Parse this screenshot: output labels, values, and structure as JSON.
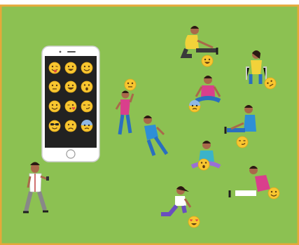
{
  "scene": {
    "background_color": "#8cc152",
    "border_color": "#e6a93a",
    "phone": {
      "body_color": "#ffffff",
      "screen_color": "#222222",
      "emoji_grid": [
        [
          "tongue-out-wink-emoji",
          "grinning-emoji",
          "smile-emoji"
        ],
        [
          "neutral-emoji",
          "grin-emoji",
          "surprised-emoji"
        ],
        [
          "smile-emoji",
          "kiss-heart-emoji",
          "smirk-emoji"
        ],
        [
          "sunglasses-emoji",
          "sad-emoji",
          "cold-sweat-emoji"
        ]
      ]
    },
    "people": [
      {
        "name": "teacher-with-phone",
        "shirt": "#ffffff",
        "pants": "#888888"
      },
      {
        "name": "kid-sitting-stretch-top",
        "shirt": "#f2d23a",
        "pants": "#3a3a3a",
        "emoji": "grinning-emoji"
      },
      {
        "name": "kid-sitting-chair",
        "shirt": "#f2d23a",
        "pants": "#2a6fbf",
        "emoji": "thinking-emoji"
      },
      {
        "name": "kid-cross-legged-pink",
        "shirt": "#d93f8c",
        "pants": "#2a6fbf",
        "emoji": "cold-sweat-emoji"
      },
      {
        "name": "kid-sitting-blue",
        "shirt": "#2e8fd6",
        "pants": "#2a6fbf",
        "emoji": "smirk-emoji"
      },
      {
        "name": "kid-jumping",
        "shirt": "#d93f8c",
        "pants": "#2a6fbf",
        "emoji": "neutral-emoji"
      },
      {
        "name": "kid-crouching-blue",
        "shirt": "#2e8fd6",
        "pants": "#2a6fbf"
      },
      {
        "name": "kid-cross-legged-teal",
        "shirt": "#3bb3c9",
        "pants": "#9a6fd6",
        "emoji": "surprised-emoji"
      },
      {
        "name": "kid-lying-pink",
        "shirt": "#d93f8c",
        "pants": "#ffffff",
        "emoji": "cool-emoji"
      },
      {
        "name": "kid-kneeling-purple",
        "shirt": "#ffffff",
        "pants": "#6a4fbf",
        "emoji": "heart-eyes-emoji"
      }
    ]
  }
}
